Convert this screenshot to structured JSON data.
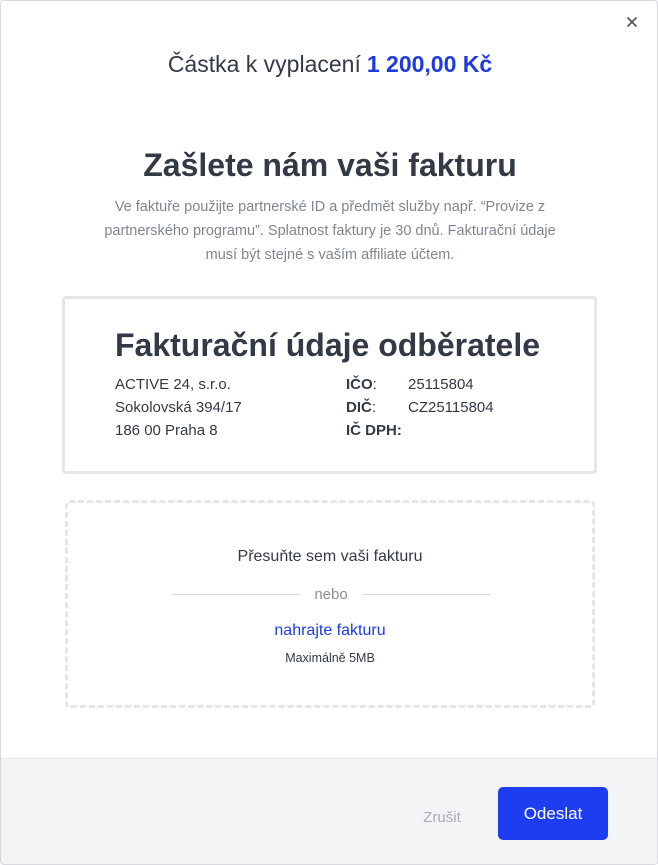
{
  "header": {
    "amount_label": "Částka k vyplacení",
    "amount_value": "1 200,00 Kč"
  },
  "main": {
    "title": "Zašlete nám vaši fakturu",
    "description": "Ve faktuře použijte partnerské ID a předmět služby např. “Provize z partnerského programu”. Splatnost faktury je 30 dnů. Fakturační údaje musí být stejné s vaším affiliate účtem."
  },
  "billing": {
    "title": "Fakturační údaje odběratele",
    "address": [
      "ACTIVE 24, s.r.o.",
      "Sokolovská 394/17",
      "186 00 Praha 8"
    ],
    "ids": [
      {
        "key": "IČO",
        "value": "25115804"
      },
      {
        "key": "DIČ",
        "value": "CZ25115804"
      },
      {
        "key": "IČ DPH",
        "value": ""
      }
    ]
  },
  "dropzone": {
    "drop_text": "Přesuňte sem vaši fakturu",
    "or_text": "nebo",
    "upload_link": "nahrajte fakturu",
    "max_size": "Maximálně 5MB"
  },
  "footer": {
    "cancel_label": "Zrušit",
    "send_label": "Odeslat"
  },
  "colors": {
    "accent": "#1f3df0",
    "text": "#333a45",
    "muted": "#7f8590",
    "border": "#e4e6ea"
  },
  "icons": {
    "close": "close-icon"
  }
}
